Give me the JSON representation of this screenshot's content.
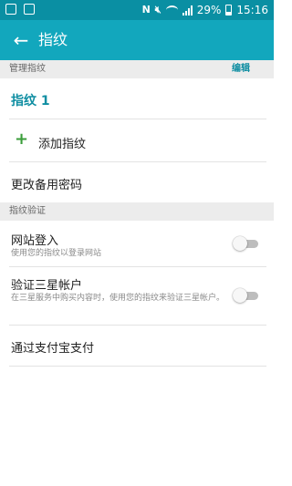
{
  "status_bar": {
    "battery_percent": "29%",
    "time": "15:16",
    "n_glyph": "N",
    "icons": [
      "gallery-notification-icon",
      "app-notification-icon",
      "nfc-icon",
      "mute-icon",
      "wifi-icon",
      "signal-icon",
      "battery-icon"
    ]
  },
  "app_bar": {
    "title": "指纹",
    "back_icon": "←"
  },
  "manage_section": {
    "header": "管理指纹",
    "edit_label": "编辑",
    "fingerprint_name": "指纹 1",
    "add_icon": "+",
    "add_label": "添加指纹",
    "change_backup_password": "更改备用密码"
  },
  "verify_section": {
    "header": "指纹验证",
    "items": [
      {
        "title": "网站登入",
        "subtitle": "使用您的指纹以登录网站",
        "enabled": false
      },
      {
        "title": "验证三星帐户",
        "subtitle": "在三星服务中购买内容时，使用您的指纹来验证三星帐户。",
        "enabled": false
      }
    ],
    "alipay": "通过支付宝支付"
  },
  "colors": {
    "status_bar": "#0a8fa3",
    "app_bar": "#12a7bd",
    "accent": "#0f8ea2",
    "add_green": "#3a9d3a"
  }
}
